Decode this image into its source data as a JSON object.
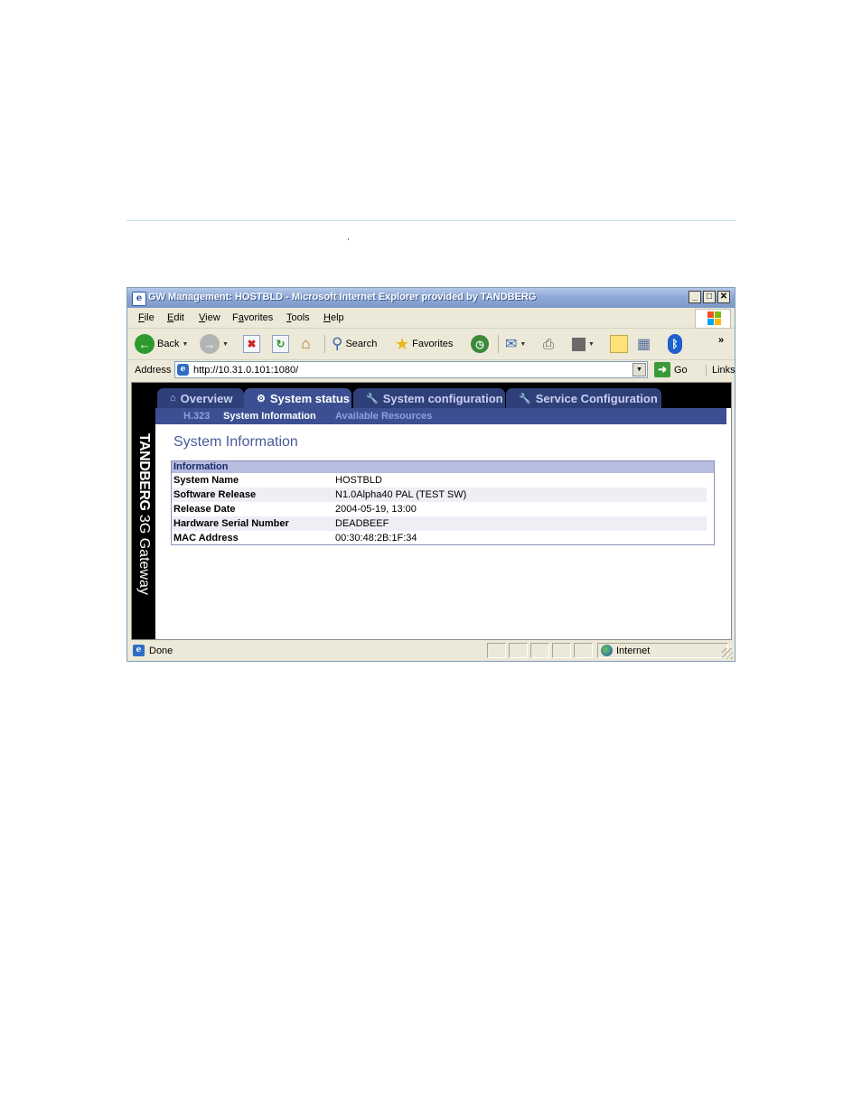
{
  "document": {
    "tick": "‘"
  },
  "window": {
    "title": "GW Management: HOSTBLD - Microsoft Internet Explorer provided by TANDBERG",
    "controls": {
      "minimize": "_",
      "maximize": "□",
      "close": "✕"
    }
  },
  "menu": {
    "items": [
      {
        "pre": "",
        "key": "F",
        "post": "ile"
      },
      {
        "pre": "",
        "key": "E",
        "post": "dit"
      },
      {
        "pre": "",
        "key": "V",
        "post": "iew"
      },
      {
        "pre": "F",
        "key": "a",
        "post": "vorites"
      },
      {
        "pre": "",
        "key": "T",
        "post": "ools"
      },
      {
        "pre": "",
        "key": "H",
        "post": "elp"
      }
    ]
  },
  "toolbar": {
    "back_label": "Back",
    "search_label": "Search",
    "favorites_label": "Favorites",
    "more": "»"
  },
  "address": {
    "label": "Address",
    "url": "http://10.31.0.101:1080/",
    "go_label": "Go",
    "links_label": "Links"
  },
  "brand": {
    "bold": "TANDBERG",
    "light": " 3G Gateway"
  },
  "tabs": [
    {
      "label": "Overview",
      "icon": "⌂"
    },
    {
      "label": "System status",
      "icon": "⚙"
    },
    {
      "label": "System configuration",
      "icon": "🔧"
    },
    {
      "label": "Service Configuration",
      "icon": "🔧"
    }
  ],
  "subnav": [
    "H.323",
    "System Information",
    "Available Resources"
  ],
  "page": {
    "title": "System Information",
    "table_header": "Information",
    "rows": [
      {
        "key": "System Name",
        "value": "HOSTBLD"
      },
      {
        "key": "Software Release",
        "value": "N1.0Alpha40 PAL (TEST SW)"
      },
      {
        "key": "Release Date",
        "value": "2004-05-19, 13:00"
      },
      {
        "key": "Hardware Serial Number",
        "value": "DEADBEEF"
      },
      {
        "key": "MAC Address",
        "value": "00:30:48:2B:1F:34"
      }
    ]
  },
  "status": {
    "text": "Done",
    "zone": "Internet"
  }
}
